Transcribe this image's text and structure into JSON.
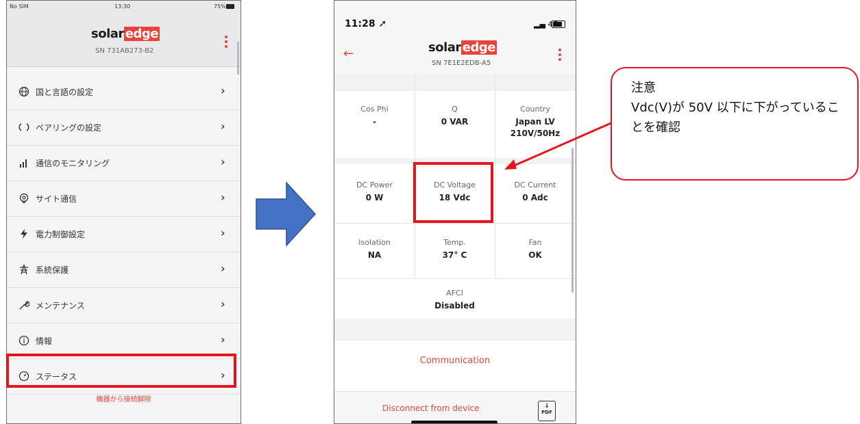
{
  "left_phone": {
    "status_bar": {
      "carrier": "No SIM",
      "time": "13:30",
      "battery": "75%"
    },
    "header": {
      "logo_part1": "solar",
      "logo_part2": "edge",
      "serial": "SN 731AB273-B2"
    },
    "menu_items": [
      {
        "label": "国と言語の設定",
        "icon": "globe-icon"
      },
      {
        "label": "ペアリングの設定",
        "icon": "pairing-icon"
      },
      {
        "label": "通信のモニタリング",
        "icon": "signal-bars-icon"
      },
      {
        "label": "サイト通信",
        "icon": "location-pin-icon"
      },
      {
        "label": "電力制御設定",
        "icon": "lightning-icon"
      },
      {
        "label": "系統保護",
        "icon": "pylon-icon"
      },
      {
        "label": "メンテナンス",
        "icon": "wrench-icon"
      },
      {
        "label": "情報",
        "icon": "info-icon"
      },
      {
        "label": "ステータス",
        "icon": "gauge-icon"
      }
    ],
    "bottom_action": "機器から接続解除"
  },
  "right_phone": {
    "status_bar": {
      "time": "11:28",
      "network": "4G"
    },
    "header": {
      "logo_part1": "solar",
      "logo_part2": "edge",
      "serial": "SN 7E1E2EDB-A5"
    },
    "rows": [
      [
        {
          "label": "Cos Phi",
          "value": "-"
        },
        {
          "label": "Q",
          "value": "0 VAR"
        },
        {
          "label": "Country",
          "value": "Japan LV 210V/50Hz"
        }
      ],
      [
        {
          "label": "DC Power",
          "value": "0 W"
        },
        {
          "label": "DC Voltage",
          "value": "18 Vdc"
        },
        {
          "label": "DC Current",
          "value": "0 Adc"
        }
      ],
      [
        {
          "label": "Isolation",
          "value": "NA"
        },
        {
          "label": "Temp.",
          "value": "37° C"
        },
        {
          "label": "Fan",
          "value": "OK"
        }
      ]
    ],
    "afci": {
      "label": "AFCI",
      "value": "Disabled"
    },
    "communication": "Communication",
    "disconnect": "Disconnect from device",
    "pdf_label": "PDF"
  },
  "callout": {
    "title": "注意",
    "text": "Vdc(V)が 50V 以下に下がっていることを確認"
  },
  "colors": {
    "accent": "#e8443a",
    "highlight": "#e3161d",
    "arrow": "#4472c4"
  }
}
